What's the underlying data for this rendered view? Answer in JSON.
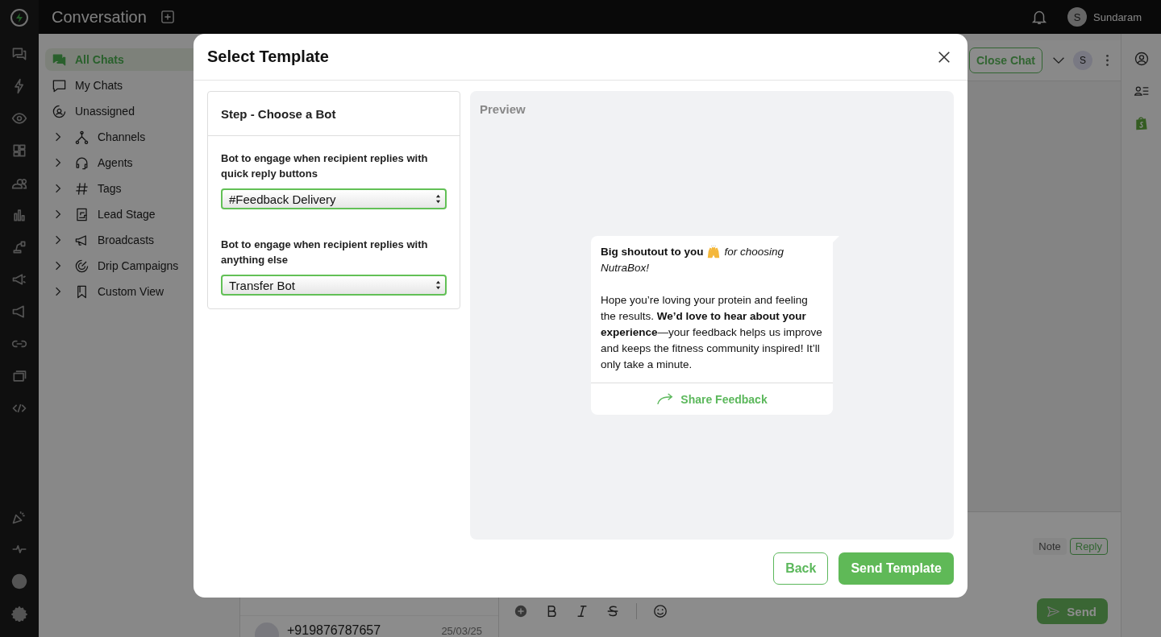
{
  "app": {
    "title": "Conversation",
    "user": {
      "initial": "S",
      "name": "Sundaram"
    }
  },
  "sidebar": {
    "items": [
      {
        "label": "All Chats",
        "selected": true,
        "expandable": false
      },
      {
        "label": "My Chats",
        "selected": false,
        "expandable": false
      },
      {
        "label": "Unassigned",
        "selected": false,
        "expandable": false
      },
      {
        "label": "Channels",
        "selected": false,
        "expandable": true
      },
      {
        "label": "Agents",
        "selected": false,
        "expandable": true
      },
      {
        "label": "Tags",
        "selected": false,
        "expandable": true
      },
      {
        "label": "Lead Stage",
        "selected": false,
        "expandable": true
      },
      {
        "label": "Broadcasts",
        "selected": false,
        "expandable": true
      },
      {
        "label": "Drip Campaigns",
        "selected": false,
        "expandable": true
      },
      {
        "label": "Custom View",
        "selected": false,
        "expandable": true
      }
    ]
  },
  "chat_list": {
    "items": [
      {
        "name": "+919876787657",
        "date": "25/03/25"
      }
    ]
  },
  "chat": {
    "close_button": "Close Chat",
    "assignee_initial": "S",
    "composer": {
      "modes": [
        {
          "label": "Note",
          "selected": false
        },
        {
          "label": "Reply",
          "selected": true
        }
      ],
      "send_button": "Send"
    }
  },
  "modal": {
    "title": "Select Template",
    "step_title": "Step - Choose a Bot",
    "fields": [
      {
        "label": "Bot to engage when recipient replies with quick reply buttons",
        "value": "#Feedback Delivery"
      },
      {
        "label": "Bot to engage when recipient replies with anything else",
        "value": "Transfer Bot"
      }
    ],
    "preview": {
      "title": "Preview",
      "message": {
        "heading": "Big shoutout to you",
        "heading_rest": [
          "for choosing",
          "NutraBox!"
        ],
        "body": "Hope you’re loving your protein and feeling the results. **We’d love to hear about your experience**—your feedback helps us improve and keeps the fitness community inspired! It’ll only take a minute.",
        "button": "Share Feedback"
      }
    },
    "buttons": {
      "back": "Back",
      "send": "Send Template"
    }
  }
}
